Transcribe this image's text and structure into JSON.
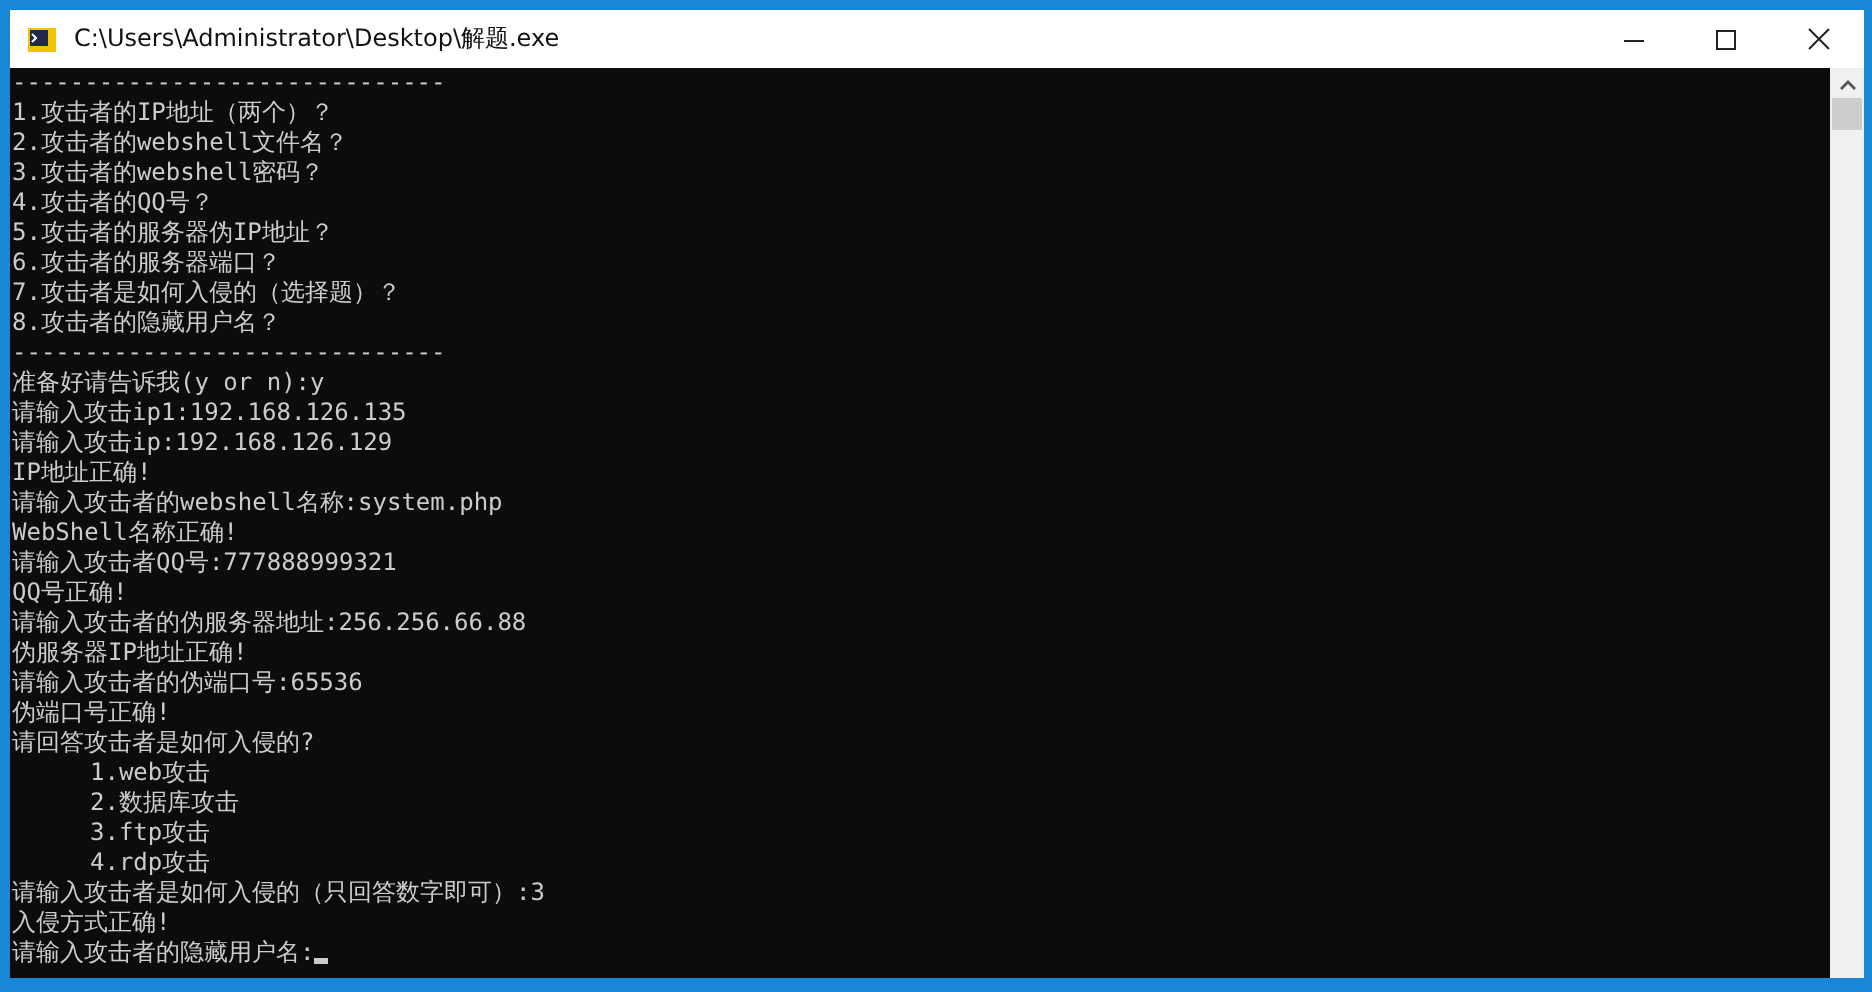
{
  "window": {
    "title": "C:\\Users\\Administrator\\Desktop\\解题.exe"
  },
  "console": {
    "cursor": true,
    "lines": [
      {
        "text": "------------------------------",
        "kind": "line"
      },
      {
        "text": "1.攻击者的IP地址（两个）？",
        "kind": "line"
      },
      {
        "text": "2.攻击者的webshell文件名？",
        "kind": "line"
      },
      {
        "text": "3.攻击者的webshell密码？",
        "kind": "line"
      },
      {
        "text": "4.攻击者的QQ号？",
        "kind": "line"
      },
      {
        "text": "5.攻击者的服务器伪IP地址？",
        "kind": "line"
      },
      {
        "text": "6.攻击者的服务器端口？",
        "kind": "line"
      },
      {
        "text": "7.攻击者是如何入侵的（选择题）？",
        "kind": "line"
      },
      {
        "text": "8.攻击者的隐藏用户名？",
        "kind": "line"
      },
      {
        "text": "------------------------------",
        "kind": "line"
      },
      {
        "text": "准备好请告诉我(y or n):y",
        "kind": "line"
      },
      {
        "text": "请输入攻击ip1:192.168.126.135",
        "kind": "line"
      },
      {
        "text": "请输入攻击ip:192.168.126.129",
        "kind": "line"
      },
      {
        "text": "IP地址正确!",
        "kind": "line"
      },
      {
        "text": "请输入攻击者的webshell名称:system.php",
        "kind": "line"
      },
      {
        "text": "WebShell名称正确!",
        "kind": "line"
      },
      {
        "text": "请输入攻击者QQ号:777888999321",
        "kind": "line"
      },
      {
        "text": "QQ号正确!",
        "kind": "line"
      },
      {
        "text": "请输入攻击者的伪服务器地址:256.256.66.88",
        "kind": "line"
      },
      {
        "text": "伪服务器IP地址正确!",
        "kind": "line"
      },
      {
        "text": "请输入攻击者的伪端口号:65536",
        "kind": "line"
      },
      {
        "text": "伪端口号正确!",
        "kind": "line"
      },
      {
        "text": "请回答攻击者是如何入侵的?",
        "kind": "line"
      },
      {
        "text": "1.web攻击",
        "kind": "option"
      },
      {
        "text": "2.数据库攻击",
        "kind": "option"
      },
      {
        "text": "3.ftp攻击",
        "kind": "option"
      },
      {
        "text": "4.rdp攻击",
        "kind": "option"
      },
      {
        "text": "请输入攻击者是如何入侵的（只回答数字即可）:3",
        "kind": "line"
      },
      {
        "text": "入侵方式正确!",
        "kind": "line"
      },
      {
        "text": "请输入攻击者的隐藏用户名:",
        "kind": "line"
      }
    ]
  }
}
